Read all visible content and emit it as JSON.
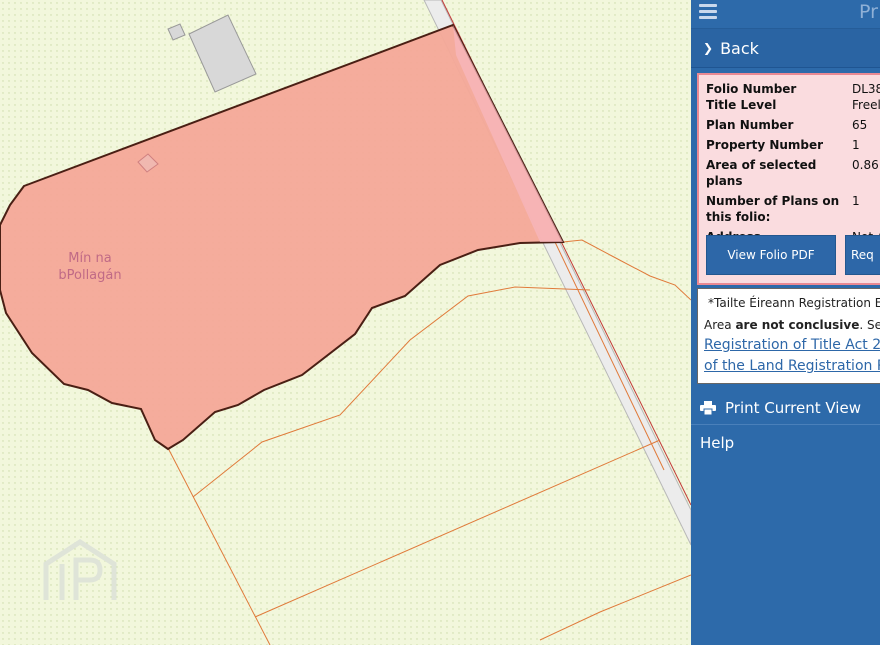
{
  "map": {
    "place_label_line1": "Mín na",
    "place_label_line2": "bPollagán"
  },
  "panel": {
    "title_partial": "Pr",
    "back_label": "Back",
    "folio": {
      "rows": [
        {
          "label": "Folio Number",
          "value": "DL38"
        },
        {
          "label": "Title Level",
          "value": "Freel"
        },
        {
          "label": "Plan Number",
          "value": "65"
        },
        {
          "label": "Property Number",
          "value": "1"
        },
        {
          "label": "Area of selected plans",
          "value": "0.86"
        },
        {
          "label": "Number of Plans on this folio:",
          "value": "1"
        },
        {
          "label": "Address",
          "value": "Not A"
        }
      ],
      "view_pdf_label": "View Folio PDF",
      "request_label": "Req"
    },
    "notice": {
      "line1": "*Tailte Éireann Registration E",
      "line2_pre": "Area ",
      "line2_bold": "are not conclusive",
      "line2_post": ". See",
      "link1": "Registration of Title Act 2",
      "link2": "of the Land Registration R"
    },
    "print_label": "Print Current View",
    "help_label": "Help"
  },
  "colors": {
    "parcel_fill": "#f4a898",
    "parcel_stroke": "#4a1f14",
    "panel_bg": "#2d6aaa",
    "map_bg": "#f2f7dc",
    "boundary_line": "#e07a3a"
  }
}
